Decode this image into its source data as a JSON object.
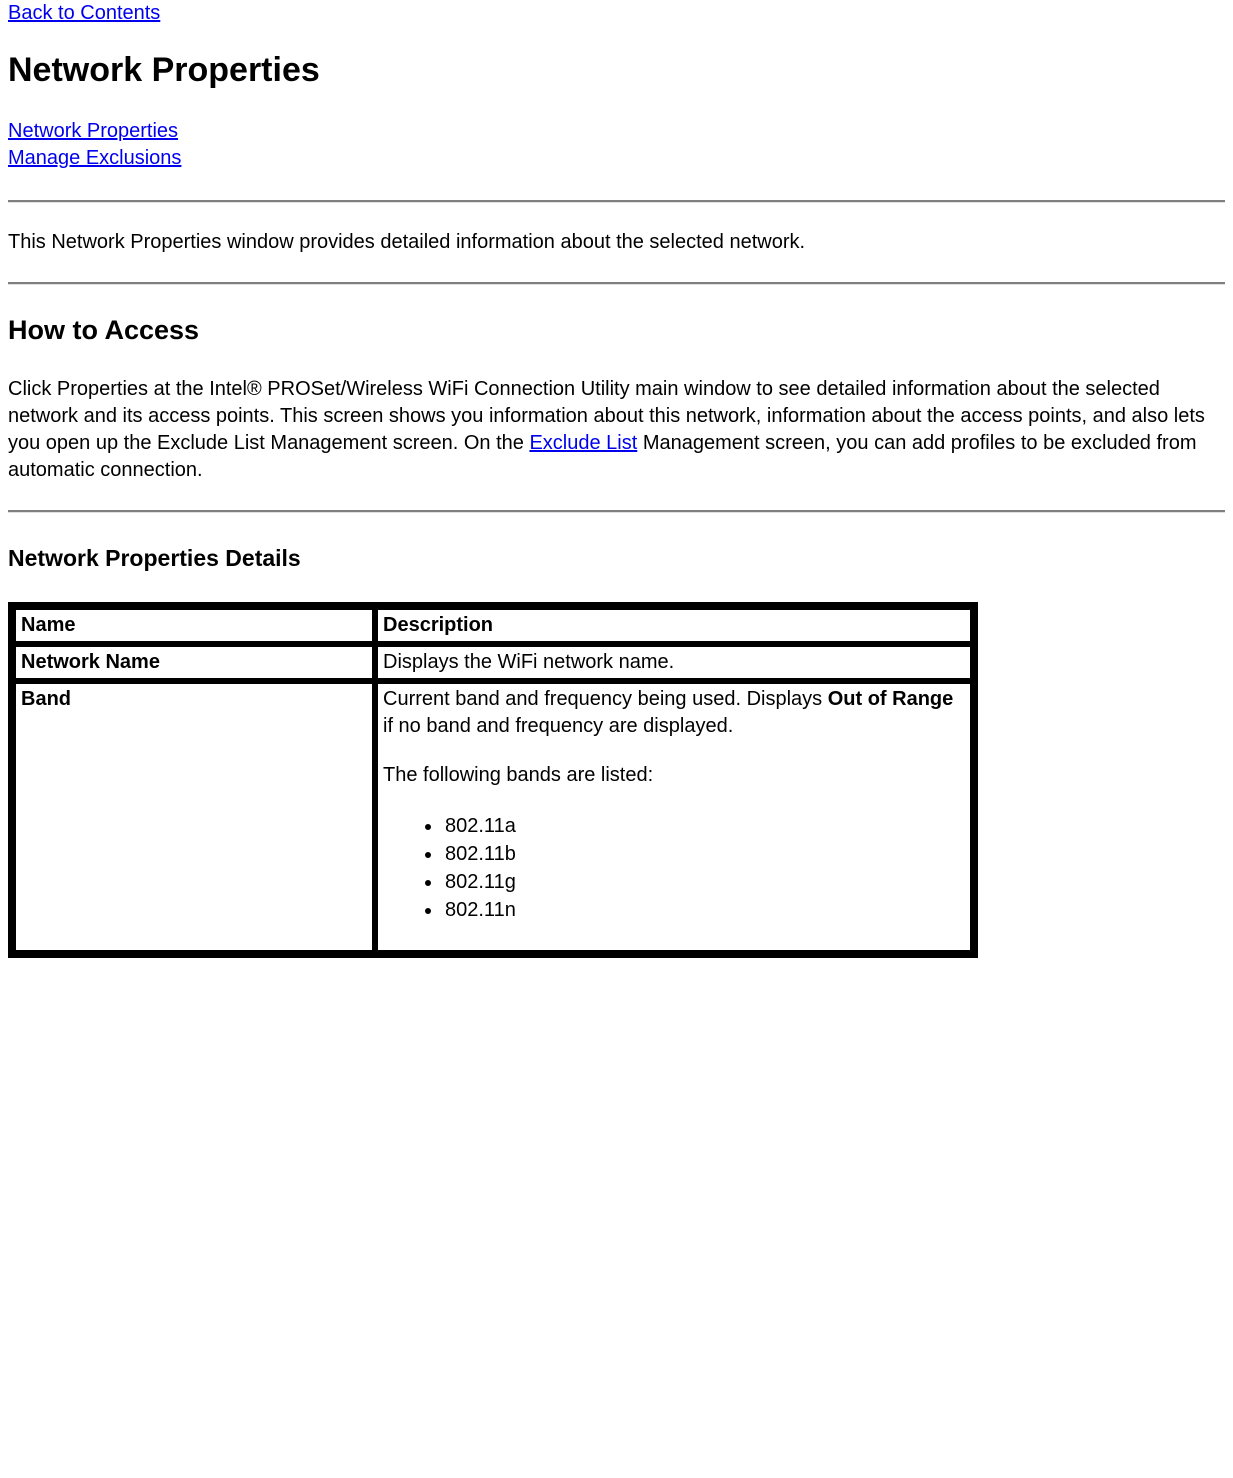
{
  "top_link": "Back to Contents",
  "h1": "Network Properties",
  "nav": {
    "link1": "Network Properties",
    "link2": "Manage Exclusions"
  },
  "intro_para": "This Network Properties window provides detailed information about the selected network.",
  "how_to_access": {
    "heading": "How to Access",
    "para_before": "Click Properties at the Intel® PROSet/Wireless WiFi Connection Utility main window to see detailed information about the selected network and its access points. This screen shows you information about this network, information about the access points, and also lets you open up the Exclude List Management screen. On the ",
    "link_text": "Exclude List",
    "para_after": " Management screen, you can add profiles to be excluded from automatic connection."
  },
  "details": {
    "heading": "Network Properties Details",
    "headers": {
      "name": "Name",
      "description": "Description"
    },
    "rows": [
      {
        "name": "Network Name",
        "description": "Displays the WiFi network name."
      },
      {
        "name": "Band",
        "desc_para1_before": "Current band and frequency being used. Displays ",
        "desc_para1_bold": "Out of Range",
        "desc_para1_after": " if no band and frequency are displayed.",
        "desc_para2": "The following bands are listed:",
        "bands": [
          "802.11a",
          "802.11b",
          "802.11g",
          "802.11n"
        ]
      }
    ]
  }
}
